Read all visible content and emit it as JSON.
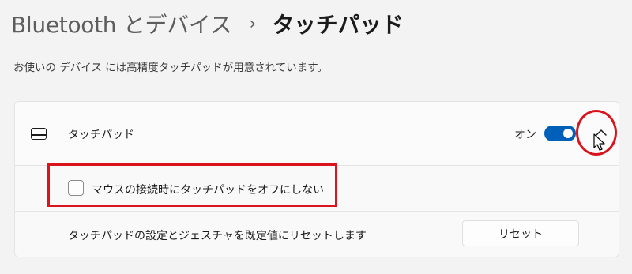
{
  "breadcrumb": {
    "parent": "Bluetooth とデバイス",
    "separator": "›",
    "current": "タッチパッド"
  },
  "description": "お使いの デバイス には高精度タッチパッドが用意されています。",
  "touchpad": {
    "icon": "touchpad-icon",
    "label": "タッチパッド",
    "toggle_state_label": "オン",
    "toggle_on": true,
    "expand_icon": "chevron-up-icon"
  },
  "options": {
    "keep_on_with_mouse_label": "マウスの接続時にタッチパッドをオフにしない",
    "keep_on_with_mouse_checked": false
  },
  "reset": {
    "description": "タッチパッドの設定とジェスチャを既定値にリセットします",
    "button_label": "リセット"
  },
  "colors": {
    "accent": "#005fb8",
    "annotation": "#d9141c",
    "background": "#f3f3f3",
    "card": "#fbfbfb"
  }
}
